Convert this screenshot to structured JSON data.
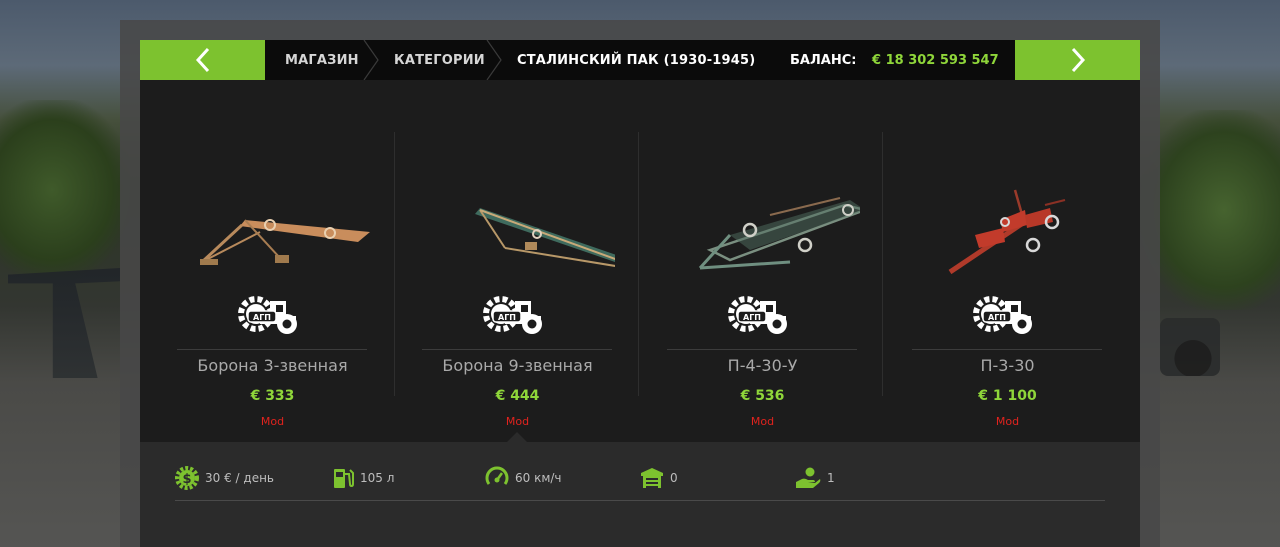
{
  "header": {
    "breadcrumb": [
      "МАГАЗИН",
      "КАТЕГОРИИ",
      "СТАЛИНСКИЙ ПАК (1930-1945)"
    ],
    "balance_label": "БАЛАНС:",
    "balance_value": "€ 18 302 593 547"
  },
  "items": [
    {
      "name": "Борона 3-звенная",
      "price": "€ 333",
      "tag": "Mod",
      "brand": "АГП"
    },
    {
      "name": "Борона 9-звенная",
      "price": "€ 444",
      "tag": "Mod",
      "brand": "АГП"
    },
    {
      "name": "П-4-30-У",
      "price": "€ 536",
      "tag": "Mod",
      "brand": "АГП"
    },
    {
      "name": "П-3-30",
      "price": "€ 1 100",
      "tag": "Mod",
      "brand": "АГП"
    }
  ],
  "selected_index": 1,
  "stats": [
    {
      "icon": "dollar-gear-icon",
      "text": "30 € / день"
    },
    {
      "icon": "fuel-pump-icon",
      "text": "105 л"
    },
    {
      "icon": "speedometer-icon",
      "text": "60 км/ч"
    },
    {
      "icon": "garage-icon",
      "text": "0"
    },
    {
      "icon": "hand-coin-icon",
      "text": "1"
    }
  ],
  "colors": {
    "accent": "#7dc22f",
    "price": "#8fd63a",
    "mod_tag": "#e0231e"
  }
}
